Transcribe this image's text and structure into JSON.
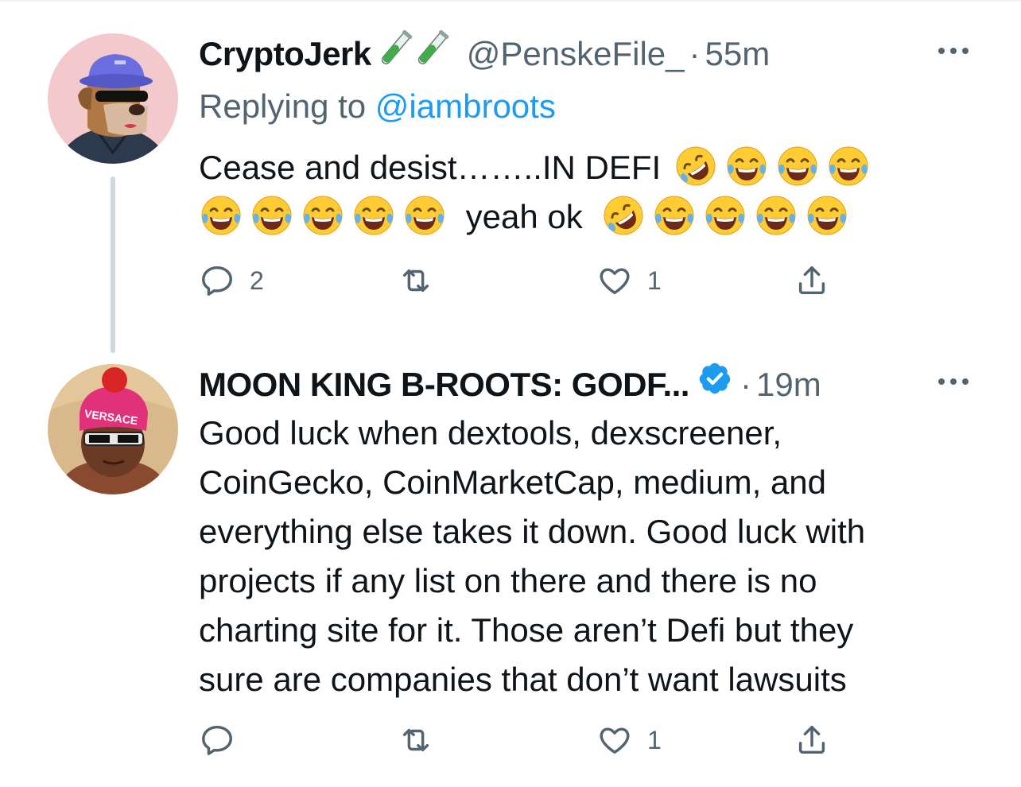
{
  "tweet1": {
    "display_name": "CryptoJerk",
    "badge_icons": [
      "test-tube-icon",
      "test-tube-icon"
    ],
    "handle": "@PenskeFile_",
    "dot": "·",
    "time": "55m",
    "replying_prefix": "Replying to",
    "replying_to": "@iambroots",
    "text_line1": "Cease and desist……..IN DEFI",
    "text_line2_mid": "yeah ok",
    "emoji_names": [
      "rolling-on-floor-laughing-emoji",
      "tears-of-joy-emoji"
    ],
    "reply_count": "2",
    "retweet_count": "",
    "like_count": "1"
  },
  "tweet2": {
    "display_name": "MOON KING B-ROOTS: GODF...",
    "verified_icon": "verified-badge-icon",
    "dot": "·",
    "time": "19m",
    "text_lines": [
      "Good luck when dextools, dexscreener,",
      "CoinGecko, CoinMarketCap, medium, and",
      "everything else takes it down. Good luck with",
      "projects if any list on there and there is no",
      "charting site for it. Those aren’t Defi but they",
      "sure are companies that don’t want lawsuits"
    ],
    "reply_count": "",
    "retweet_count": "",
    "like_count": "1"
  },
  "colors": {
    "text": "#0f1419",
    "secondary": "#536471",
    "link": "#1d9bf0",
    "verified": "#1d9bf0",
    "thread_line": "#cfd9de"
  },
  "avatar_texts": {
    "avatar2_hat": "VERSACE"
  }
}
